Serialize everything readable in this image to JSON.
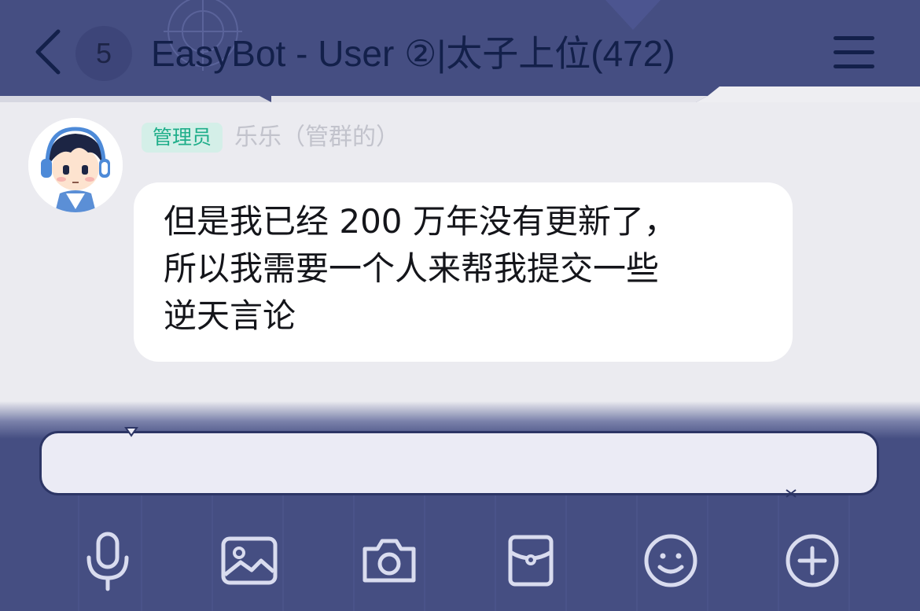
{
  "header": {
    "unread_count": "5",
    "title": "EasyBot - User ②|太子上位(472)",
    "icons": {
      "back": "chevron-left-icon",
      "menu": "hamburger-menu-icon"
    }
  },
  "message": {
    "role_badge": "管理员",
    "sender": "乐乐（管群的）",
    "lines": [
      "但是我已经 200 万年没有更新了，",
      "所以我需要一个人来帮我提交一些",
      "逆天言论"
    ]
  },
  "input": {
    "value": ""
  },
  "toolbar": {
    "icons": [
      "microphone-icon",
      "image-icon",
      "camera-icon",
      "red-packet-icon",
      "emoji-icon",
      "plus-icon"
    ]
  },
  "colors": {
    "header_bg": "#454e82",
    "chat_bg": "#ebebf0",
    "title_text": "#13204a",
    "badge_text": "#1fae8a",
    "badge_bg": "#d4efe8",
    "bubble_bg": "#ffffff",
    "toolbar_icon": "#d9dcef"
  }
}
